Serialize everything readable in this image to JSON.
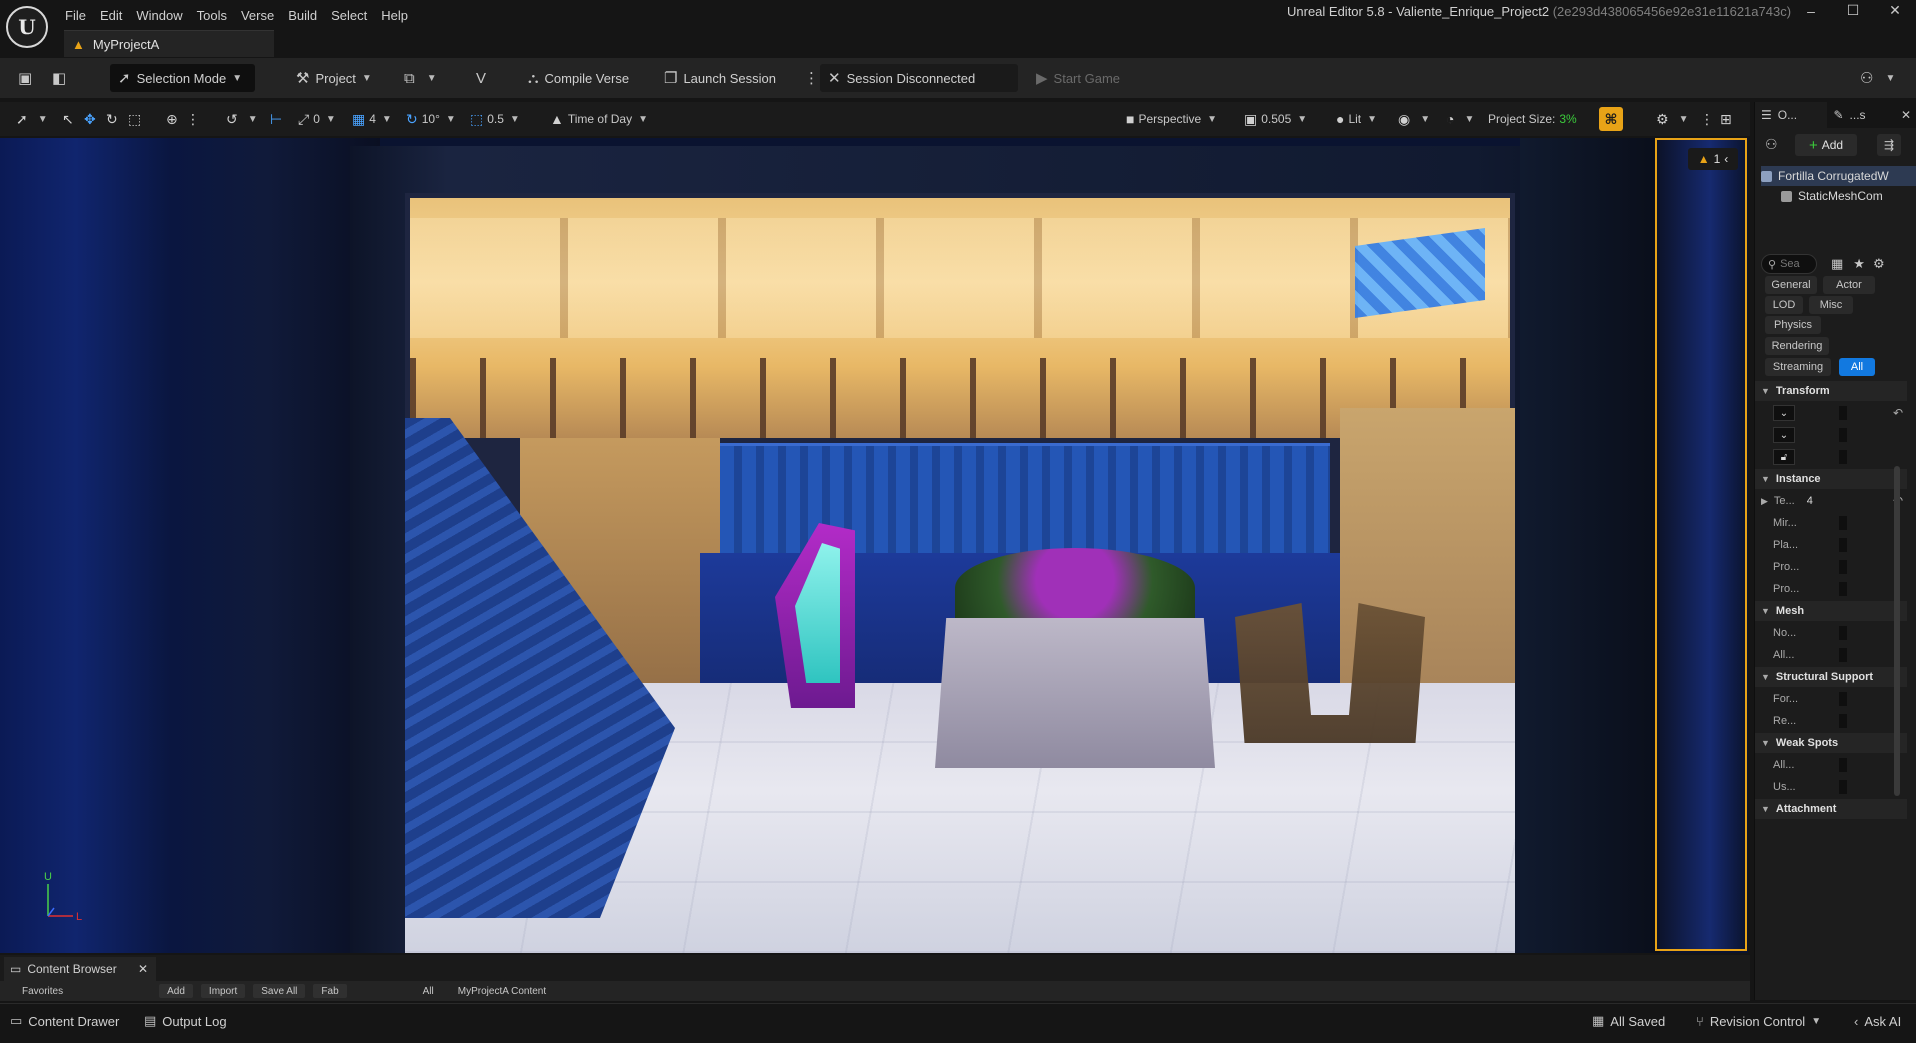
{
  "app": {
    "logo_glyph": "U",
    "window_title": "Unreal Editor 5.8 - Valiente_Enrique_Project2",
    "window_hash": "(2e293d438065456e92e31e11621a743c)",
    "project_tab": "MyProjectA",
    "menu": [
      "File",
      "Edit",
      "Window",
      "Tools",
      "Verse",
      "Build",
      "Select",
      "Help"
    ],
    "window_controls": {
      "minimize": "–",
      "maximize": "☐",
      "close": "✕"
    }
  },
  "toolbar": {
    "selection_mode": "Selection Mode",
    "project": "Project",
    "compile_verse": "Compile Verse",
    "launch_session": "Launch Session",
    "session_disconnected": "Session Disconnected",
    "start_game": "Start Game"
  },
  "viewport_toolbar": {
    "rotation_snap_value": "0",
    "grid_value": "4",
    "angle_value": "10°",
    "scale_value": "0.5",
    "time_of_day": "Time of Day",
    "perspective": "Perspective",
    "camera_speed": "0.505",
    "lit": "Lit",
    "project_size_label": "Project Size:",
    "project_size_value": "3%"
  },
  "viewport": {
    "warning_count": "1",
    "axis_up": "U",
    "axis_l": "L"
  },
  "outliner": {
    "tab_left": "O...",
    "tab_right": "...s",
    "add_label": "Add",
    "items": [
      {
        "label": "Fortilla CorrugatedW"
      },
      {
        "label": "StaticMeshCom"
      }
    ]
  },
  "details": {
    "search_placeholder": "Sea",
    "filters": [
      "General",
      "Actor",
      "LOD",
      "Misc",
      "Physics",
      "Rendering",
      "Streaming",
      "All"
    ],
    "sections": {
      "transform": "Transform",
      "instance": "Instance",
      "instance_props": [
        "Te...",
        "Mir...",
        "Pla...",
        "Pro...",
        "Pro..."
      ],
      "instance_value": "4",
      "mesh": "Mesh",
      "mesh_props": [
        "No...",
        "All..."
      ],
      "structural": "Structural Support",
      "structural_props": [
        "For...",
        "Re..."
      ],
      "weak_spots": "Weak Spots",
      "weak_props": [
        "All...",
        "Us..."
      ],
      "attachment": "Attachment"
    }
  },
  "content_browser": {
    "tab": "Content Browser",
    "strip": [
      "Favorites",
      "Add",
      "Import",
      "Save All",
      "Fab",
      "All",
      "MyProjectA Content"
    ]
  },
  "statusbar": {
    "content_drawer": "Content Drawer",
    "output_log": "Output Log",
    "all_saved": "All Saved",
    "revision_control": "Revision Control",
    "ask_ai": "Ask AI"
  }
}
